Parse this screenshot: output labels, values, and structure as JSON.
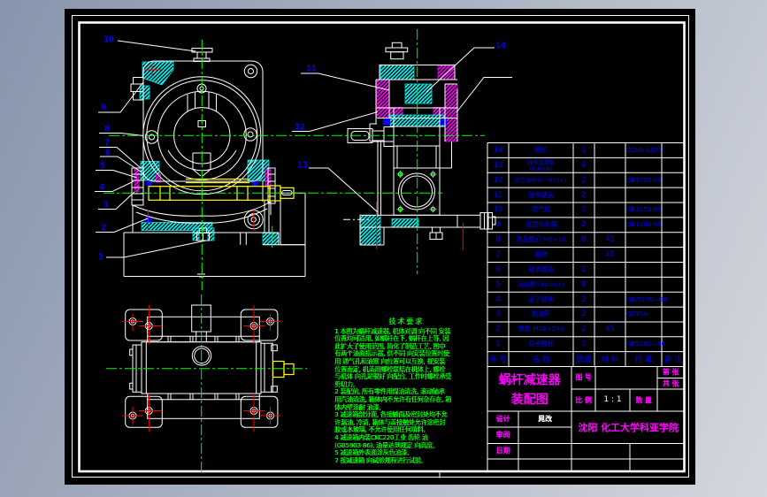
{
  "title_block": {
    "title_line1": "蜗杆减速器",
    "title_line2": "装配图",
    "fig_no_label": "图 号",
    "scale_label": "比 例",
    "scale_value": "1 : 1",
    "qty_label": "数 量",
    "sheet_no_label": "第 张",
    "sheet_total_label": "共 张",
    "design_label": "设计",
    "designer": "晁改",
    "review_label": "审阅",
    "date_label": "日期",
    "school": "沈阳 化工大学科亚学院"
  },
  "bom": {
    "headers": [
      "序 号",
      "名    称",
      "数量",
      "材 料",
      "标  准",
      "备 注"
    ],
    "rows": [
      {
        "no": "14",
        "name": "蜗轮",
        "qty": "1",
        "material": "",
        "standard": "ZCuSn10P1",
        "note": ""
      },
      {
        "no": "13",
        "name": "轴承盖螺栓|M16×80",
        "qty": "4",
        "material": "",
        "standard": "",
        "note": ""
      },
      {
        "no": "12",
        "name": "压注油杯45° M10×1",
        "qty": "2",
        "material": "",
        "standard": "GB1153-89",
        "note": ""
      },
      {
        "no": "11",
        "name": "轴承端盖",
        "qty": "2",
        "material": "",
        "standard": "",
        "note": ""
      },
      {
        "no": "10",
        "name": "通气帽",
        "qty": "1",
        "material": "",
        "standard": "GB1153-89",
        "note": ""
      },
      {
        "no": "9",
        "name": "油面指示器",
        "qty": "2",
        "material": "",
        "standard": "GB1160-89",
        "note": ""
      },
      {
        "no": "8",
        "name": "端盖螺钉 M8×10",
        "qty": "8",
        "material": "45",
        "standard": "",
        "note": ""
      },
      {
        "no": "7",
        "name": "箱体",
        "qty": "",
        "material": "45",
        "standard": "",
        "note": ""
      },
      {
        "no": "6",
        "name": "轴承端盖",
        "qty": "2",
        "material": "",
        "standard": "",
        "note": ""
      },
      {
        "no": "5",
        "name": "端盖螺钉 M10×12",
        "qty": "8",
        "material": "",
        "standard": "",
        "note": ""
      },
      {
        "no": "4",
        "name": "滚子轴承",
        "qty": "2",
        "material": "",
        "standard": "GB/T276—94",
        "note": ""
      },
      {
        "no": "3",
        "name": "挡油环",
        "qty": "2",
        "material": "",
        "standard": "Q235A",
        "note": ""
      },
      {
        "no": "2",
        "name": "螺栓 M20×240",
        "qty": "2",
        "material": "45",
        "standard": "",
        "note": ""
      },
      {
        "no": "1",
        "name": "双头螺柱",
        "qty": "1",
        "material": "",
        "standard": "GB5782—86",
        "note": ""
      }
    ]
  },
  "notes": {
    "title": "技 术 要 求",
    "lines": [
      "1 本图为蜗杆减速器, 机体对调 向不同 安装",
      "位置均可适用, 如蜗杆在下, 蜗杆在上等, 因",
      "此扩大了使用范围, 简化了制造工艺, 图中",
      "有两个油面指示器, 供不同 向安装位置时使",
      "用 通气孔和油塞 向位置可以互换, 视安装",
      "位置而定, 机盖用螺栓联结在机体上, 螺栓",
      "与机体 向孔是很好 向配合, 工作时螺栓承受",
      "剪切力,",
      "2 装配前, 所有零件用煤油清洗, 滚动轴承",
      "用汽油清洗, 箱体内不允许有任何杂存在, 箱",
      "体内壁涂耐 油漆,",
      "3 减速箱剖分面, 各接触面及密封处均不允",
      "许漏油, 冷清, 箱体与盖接触处允许涂密封",
      "胶或水玻璃, 不允许使用任何填料,",
      "4 减速箱内装CKC220工业 齿轮 油",
      "(GB5903-86), 油量达到规定 向高度,",
      "5 减速箱外表面涂灰色油漆,",
      "7 按减速箱 向试验规程进行试验,"
    ]
  },
  "balloons": [
    "1",
    "2",
    "3",
    "4",
    "5",
    "6",
    "7",
    "8",
    "9",
    "10",
    "11",
    "12",
    "13",
    "14"
  ]
}
